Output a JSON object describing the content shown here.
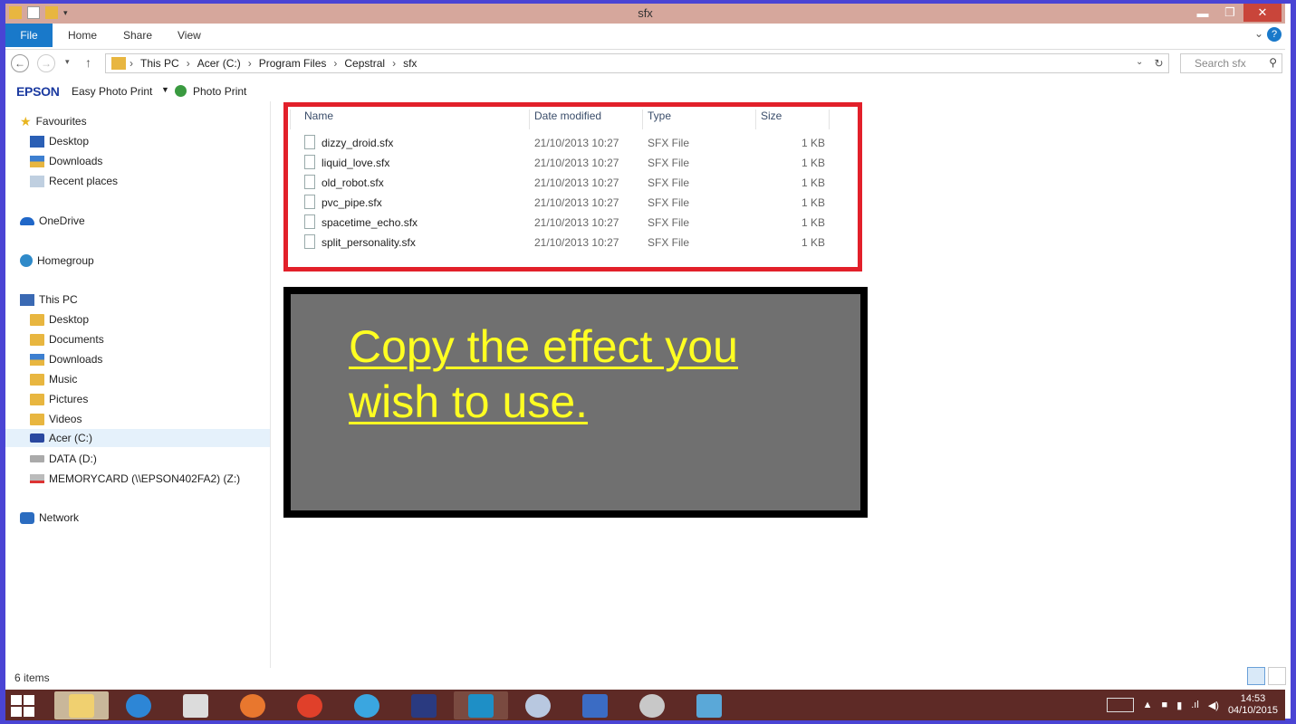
{
  "window": {
    "title": "sfx"
  },
  "ribbon": {
    "tabs": [
      "File",
      "Home",
      "Share",
      "View"
    ]
  },
  "address": {
    "crumbs": [
      "This PC",
      "Acer (C:)",
      "Program Files",
      "Cepstral",
      "sfx"
    ],
    "search_placeholder": "Search sfx"
  },
  "epson_toolbar": {
    "brand": "EPSON",
    "easy_photo_print": "Easy Photo Print",
    "photo_print": "Photo Print"
  },
  "sidebar": {
    "items": [
      {
        "label": "Favourites",
        "icon": "star-icon"
      },
      {
        "label": "Desktop",
        "icon": "desktop-icon"
      },
      {
        "label": "Downloads",
        "icon": "downloads-folder-icon"
      },
      {
        "label": "Recent places",
        "icon": "recent-places-icon"
      },
      {
        "label": "OneDrive",
        "icon": "onedrive-icon"
      },
      {
        "label": "Homegroup",
        "icon": "homegroup-icon"
      },
      {
        "label": "This PC",
        "icon": "this-pc-icon"
      },
      {
        "label": "Desktop",
        "icon": "folder-icon"
      },
      {
        "label": "Documents",
        "icon": "folder-icon"
      },
      {
        "label": "Downloads",
        "icon": "downloads-folder-icon"
      },
      {
        "label": "Music",
        "icon": "music-folder-icon"
      },
      {
        "label": "Pictures",
        "icon": "pictures-folder-icon"
      },
      {
        "label": "Videos",
        "icon": "videos-folder-icon"
      },
      {
        "label": "Acer (C:)",
        "icon": "wd-drive-icon"
      },
      {
        "label": "DATA (D:)",
        "icon": "drive-icon"
      },
      {
        "label": "MEMORYCARD (\\\\EPSON402FA2) (Z:)",
        "icon": "network-drive-disconnected-icon"
      },
      {
        "label": "Network",
        "icon": "network-icon"
      }
    ]
  },
  "files": {
    "columns": [
      "Name",
      "Date modified",
      "Type",
      "Size"
    ],
    "rows": [
      {
        "name": "dizzy_droid.sfx",
        "date": "21/10/2013 10:27",
        "type": "SFX File",
        "size": "1 KB"
      },
      {
        "name": "liquid_love.sfx",
        "date": "21/10/2013 10:27",
        "type": "SFX File",
        "size": "1 KB"
      },
      {
        "name": "old_robot.sfx",
        "date": "21/10/2013 10:27",
        "type": "SFX File",
        "size": "1 KB"
      },
      {
        "name": "pvc_pipe.sfx",
        "date": "21/10/2013 10:27",
        "type": "SFX File",
        "size": "1 KB"
      },
      {
        "name": "spacetime_echo.sfx",
        "date": "21/10/2013 10:27",
        "type": "SFX File",
        "size": "1 KB"
      },
      {
        "name": "split_personality.sfx",
        "date": "21/10/2013 10:27",
        "type": "SFX File",
        "size": "1 KB"
      }
    ]
  },
  "callout": {
    "text": "Copy the effect you wish to use."
  },
  "status": {
    "count": "6 items"
  },
  "taskbar": {
    "time": "14:53",
    "date": "04/10/2015"
  },
  "colors": {
    "frame": "#4a44d4",
    "titlebar": "#d6a79c",
    "highlight_box": "#e2202a",
    "callout_text": "#ffff22",
    "taskbar": "#5e2a26"
  }
}
